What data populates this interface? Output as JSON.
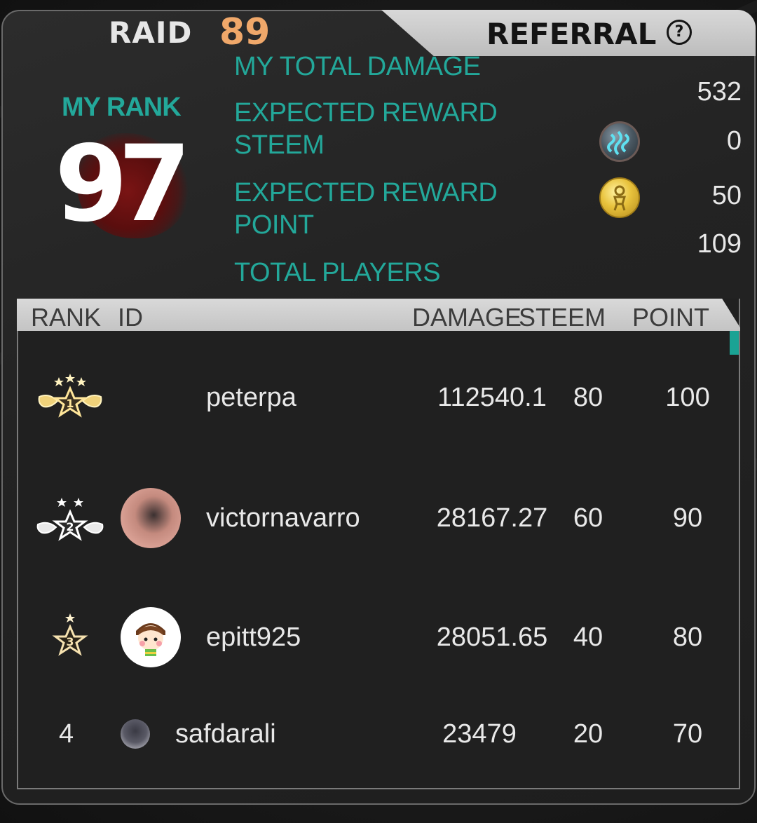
{
  "header": {
    "raid_label": "RAID",
    "raid_number": "89",
    "referral_label": "REFERRAL",
    "help_glyph": "?"
  },
  "stats": {
    "my_rank_label": "MY RANK",
    "my_rank_value": "97",
    "total_damage_label": "MY TOTAL DAMAGE",
    "total_damage_value": "532",
    "expected_steem_label_line1": "EXPECTED REWARD",
    "expected_steem_label_line2": "STEEM",
    "expected_steem_value": "0",
    "expected_point_label_line1": "EXPECTED REWARD",
    "expected_point_label_line2": "POINT",
    "expected_point_value": "50",
    "total_players_label": "TOTAL PLAYERS",
    "total_players_value": "109",
    "steem_icon": "steem-logo-icon",
    "point_icon": "gold-coin-icon"
  },
  "table": {
    "headers": {
      "rank": "RANK",
      "id": "ID",
      "damage": "DAMAGE",
      "steem": "STEEM",
      "point": "POINT"
    },
    "rows": [
      {
        "rank": "1",
        "name": "peterpa",
        "damage": "112540.1",
        "steem": "80",
        "point": "100"
      },
      {
        "rank": "2",
        "name": "victornavarro",
        "damage": "28167.27",
        "steem": "60",
        "point": "90"
      },
      {
        "rank": "3",
        "name": "epitt925",
        "damage": "28051.65",
        "steem": "40",
        "point": "80"
      },
      {
        "rank": "4",
        "name": "safdarali",
        "damage": "23479",
        "steem": "20",
        "point": "70"
      }
    ]
  },
  "colors": {
    "accent_teal": "#23a89a",
    "raid_number": "#f0a86a",
    "rank_splatter": "#7a1414"
  }
}
